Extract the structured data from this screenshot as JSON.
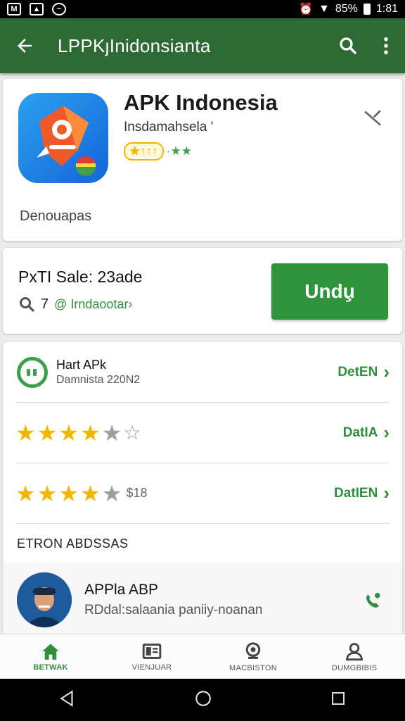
{
  "status_bar": {
    "battery": "85%",
    "time": "1:81"
  },
  "app_bar": {
    "title": "LPPKȷInidonsianta"
  },
  "app_card": {
    "name": "APK Indonesia",
    "developer": "Insdamahsela '",
    "rating_pill": "★↑↑↑",
    "rating_extra": "·★★",
    "category": "Denouapas"
  },
  "promo": {
    "title": "PxTI Sale: 23ade",
    "count": "7",
    "link": "@ Irndaootar›",
    "install_label": "Undu̧"
  },
  "rows": [
    {
      "title": "Hart APk",
      "subtitle": "Damnista 220N2",
      "detail": "DetEN",
      "arrow": "›"
    },
    {
      "stars_on": 4,
      "stars_total": 6,
      "detail": "DatIA",
      "arrow": "›"
    },
    {
      "stars_on": 4,
      "stars_total": 5,
      "count": "$18",
      "detail": "DatIEN",
      "arrow": "›"
    }
  ],
  "section": {
    "label": "ETRON ABDSSAS"
  },
  "user": {
    "name": "APPla ABP",
    "description": "RDdal:salaania paniiy-noanan"
  },
  "bottom_nav": [
    {
      "label": "BETWAK",
      "icon": "home-icon",
      "active": true
    },
    {
      "label": "VIENJUAR",
      "icon": "book-icon",
      "active": false
    },
    {
      "label": "MACBISTON",
      "icon": "pin-icon",
      "active": false
    },
    {
      "label": "DUMGBIBIS",
      "icon": "person-icon",
      "active": false
    }
  ],
  "colors": {
    "app_bar": "#2e6a35",
    "accent": "#2f933c",
    "star": "#f2b600"
  }
}
